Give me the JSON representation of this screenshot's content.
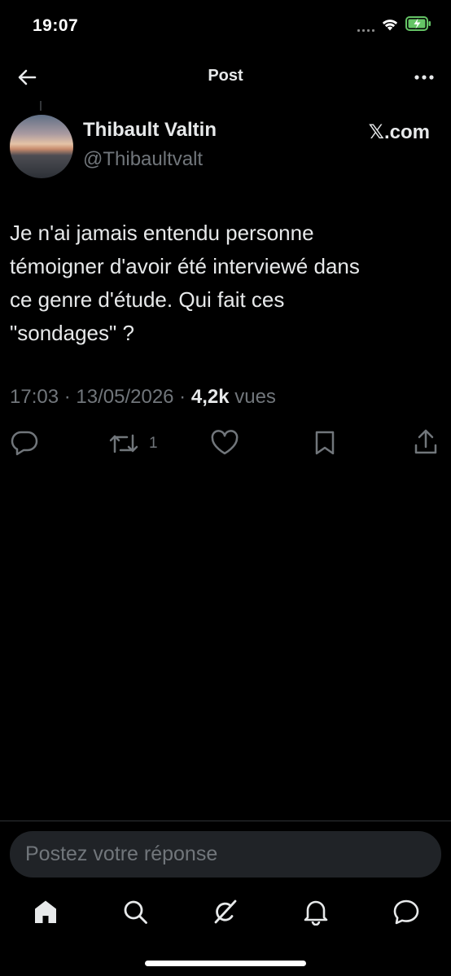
{
  "status_bar": {
    "time": "19:07"
  },
  "header": {
    "title": "Post"
  },
  "post": {
    "author_name": "Thibault Valtin",
    "author_handle": "@Thibaultvalt",
    "source": "𝕏.com",
    "text": "Je n'ai jamais entendu personne\ntémoigner d'avoir été interviewé dans\nce genre d'étude. Qui fait ces\n\"sondages\" ?",
    "time": "17:03",
    "date": "13/05/2026",
    "views_count": "4,2k",
    "views_label": "vues",
    "retweet_count": "1"
  },
  "reply": {
    "placeholder": "Postez votre réponse"
  },
  "icons": {
    "header": [
      "back-arrow-icon",
      "more-icon"
    ],
    "actions": [
      "reply-icon",
      "retweet-icon",
      "like-icon",
      "bookmark-icon",
      "share-icon"
    ],
    "tab_bar": [
      "home-icon",
      "search-icon",
      "grok-icon",
      "notifications-icon",
      "messages-icon"
    ]
  },
  "colors": {
    "background": "#000000",
    "text": "#e7e9ea",
    "secondary": "#71767b",
    "battery": "#65c466"
  }
}
